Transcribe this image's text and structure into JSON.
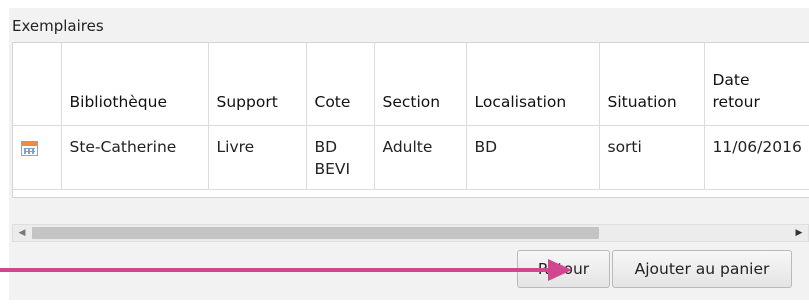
{
  "section": {
    "title": "Exemplaires"
  },
  "table": {
    "headers": {
      "icon": "",
      "bibliotheque": "Bibliothèque",
      "support": "Support",
      "cote": "Cote",
      "section": "Section",
      "localisation": "Localisation",
      "situation": "Situation",
      "date_retour_line1": "Date",
      "date_retour_line2": "retour"
    },
    "rows": [
      {
        "icon": "calendar-icon",
        "bibliotheque": "Ste-Catherine",
        "support": "Livre",
        "cote_line1": "BD",
        "cote_line2": "BEVI",
        "section": "Adulte",
        "localisation": "BD",
        "situation": "sorti",
        "date_retour": "11/06/2016"
      }
    ]
  },
  "buttons": {
    "retour": "Retour",
    "ajouter_panier": "Ajouter au panier"
  },
  "annotation": {
    "arrow_color": "#d1478f"
  }
}
